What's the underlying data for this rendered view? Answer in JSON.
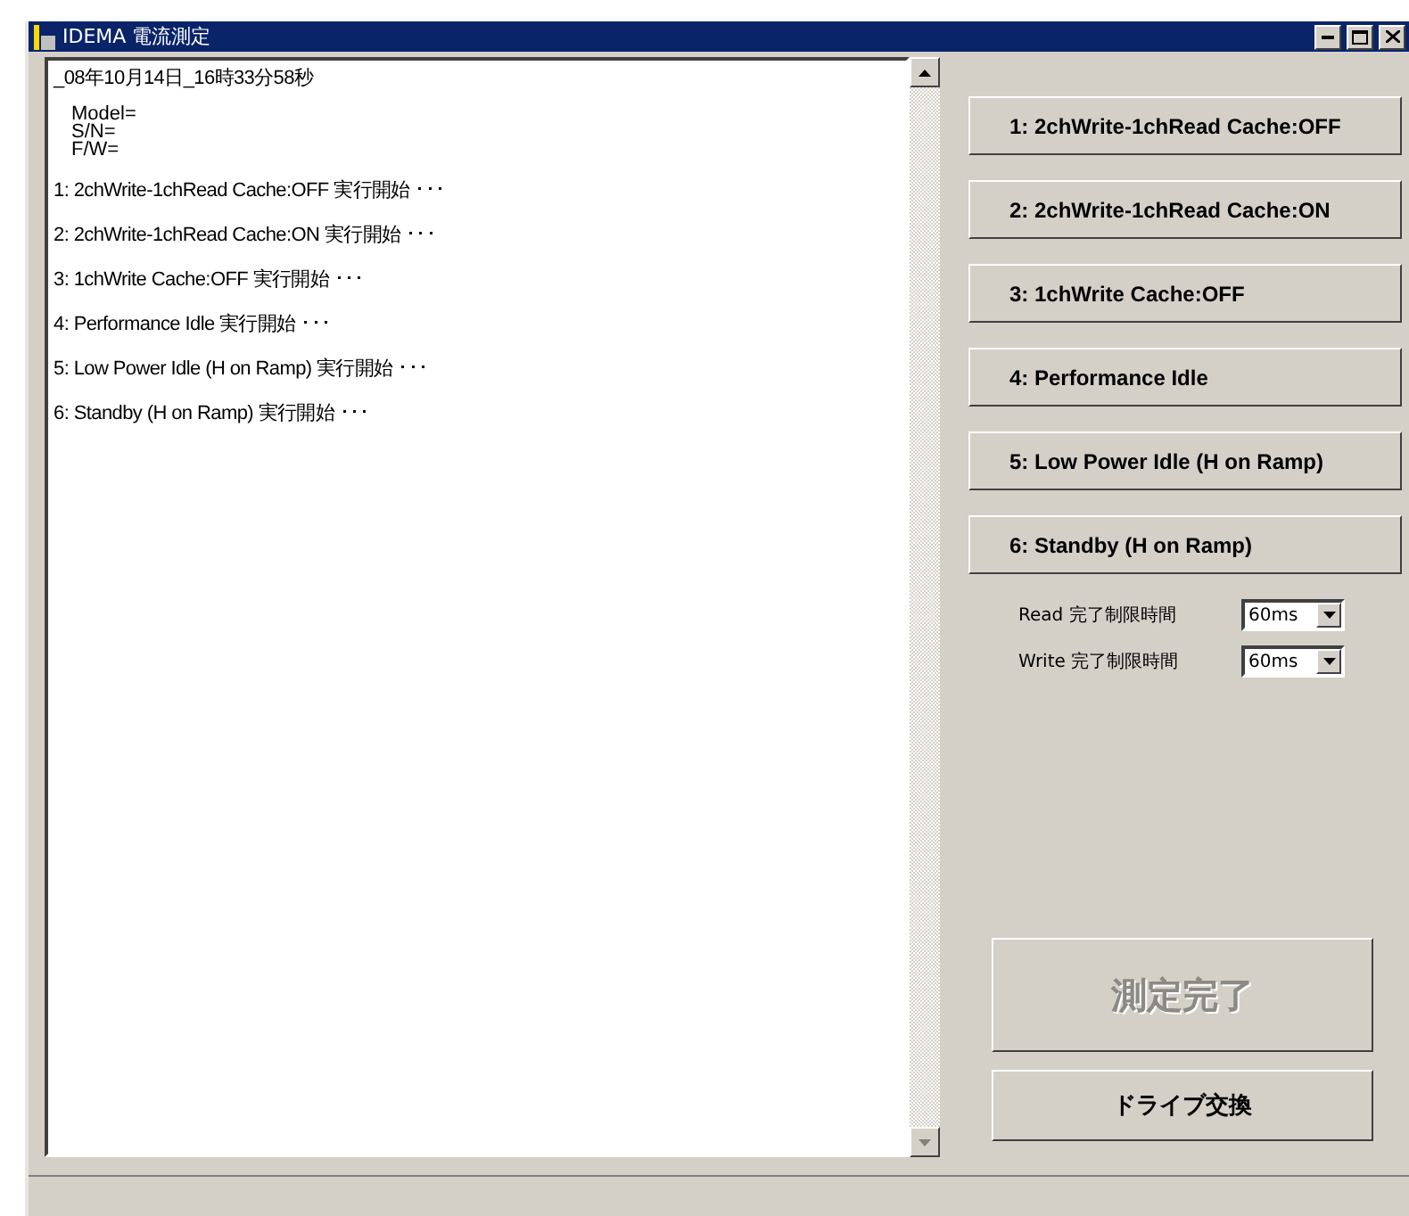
{
  "window": {
    "title": "IDEMA 電流測定"
  },
  "log": {
    "timestamp": "_08年10月14日_16時33分58秒",
    "info": [
      "Model=",
      "S/N=",
      "F/W="
    ],
    "lines": [
      "1:  2chWrite-1chRead Cache:OFF 実行開始 ･･･",
      "2:  2chWrite-1chRead Cache:ON 実行開始 ･･･",
      "3:  1chWrite Cache:OFF 実行開始 ･･･",
      "4:  Performance Idle 実行開始 ･･･",
      "5:  Low Power Idle (H on Ramp) 実行開始 ･･･",
      "6:  Standby (H on Ramp) 実行開始 ･･･"
    ]
  },
  "test_buttons": [
    "1:  2chWrite-1chRead Cache:OFF",
    "2:  2chWrite-1chRead Cache:ON",
    "3:  1chWrite Cache:OFF",
    "4:  Performance Idle",
    "5:  Low Power Idle (H on Ramp)",
    "6:  Standby (H on Ramp)"
  ],
  "timeouts": [
    {
      "label": "Read 完了制限時間",
      "value": "60ms"
    },
    {
      "label": "Write 完了制限時間",
      "value": "60ms"
    }
  ],
  "finish_button": {
    "label": "測定完了",
    "disabled": true
  },
  "exchange_button": {
    "label": "ドライブ交換",
    "disabled": false
  }
}
